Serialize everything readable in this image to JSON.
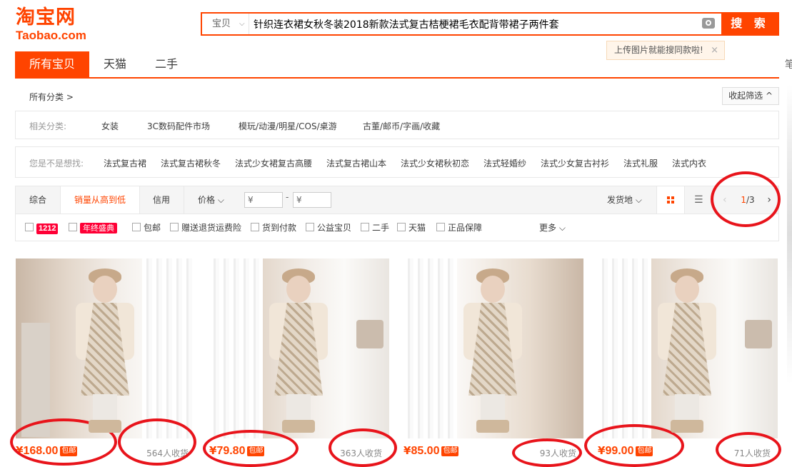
{
  "logo": {
    "cn": "淘宝网",
    "en": "Taobao.com"
  },
  "search": {
    "scope": "宝贝",
    "query": "针织连衣裙女秋冬装2018新款法式复古桔梗裙毛衣配背带裙子两件套",
    "button": "搜 索",
    "camera_icon": "camera-icon"
  },
  "tip": {
    "text": "上传图片就能搜同款啦!",
    "close": "×"
  },
  "right_edge": "笔",
  "tabs": [
    {
      "label": "所有宝贝",
      "active": true
    },
    {
      "label": "天猫",
      "active": false
    },
    {
      "label": "二手",
      "active": false
    }
  ],
  "crumb": {
    "all": "所有分类 >",
    "collapse": "收起筛选 ^"
  },
  "related": {
    "label": "相关分类:",
    "items": [
      "女装",
      "3C数码配件市场",
      "模玩/动漫/明星/COS/桌游",
      "古董/邮币/字画/收藏"
    ]
  },
  "suggest": {
    "label": "您是不是想找:",
    "items": [
      "法式复古裙",
      "法式复古裙秋冬",
      "法式少女裙复古高腰",
      "法式复古裙山本",
      "法式少女裙秋初恋",
      "法式轻婚纱",
      "法式少女复古衬衫",
      "法式礼服",
      "法式内衣"
    ]
  },
  "sort": {
    "items": [
      "综合",
      "销量从高到低",
      "信用",
      "价格 ⌵"
    ],
    "active_index": 1,
    "price_from": "¥",
    "price_dash": "-",
    "price_to": "¥",
    "ship_from": "发货地 ⌵",
    "pager": {
      "current": "1",
      "total": "/3",
      "prev": "‹",
      "next": "›"
    }
  },
  "filters": {
    "badge_1212": "1212",
    "badge_year": "年终盛典",
    "items": [
      "包邮",
      "赠送退货运费险",
      "货到付款",
      "公益宝贝",
      "二手",
      "天猫",
      "正品保障"
    ],
    "more": "更多 ⌵"
  },
  "products": [
    {
      "yen": "¥",
      "price": "168.00",
      "free": "包邮",
      "sold": "564人收货"
    },
    {
      "yen": "¥",
      "price": "79.80",
      "free": "包邮",
      "sold": "363人收货"
    },
    {
      "yen": "¥",
      "price": "85.00",
      "free": "包邮",
      "sold": "93人收货"
    },
    {
      "yen": "¥",
      "price": "99.00",
      "free": "包邮",
      "sold": "71人收货"
    }
  ],
  "colors": {
    "accent": "#ff4400",
    "annotation": "#e8141b"
  }
}
